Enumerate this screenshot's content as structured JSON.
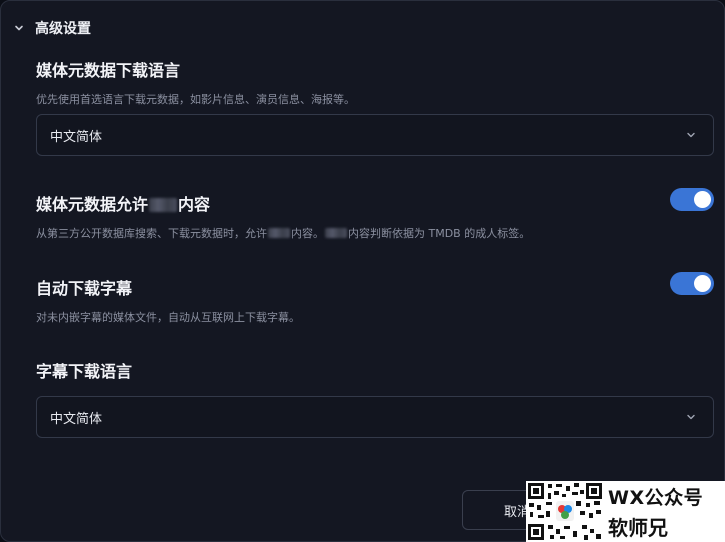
{
  "section": {
    "title": "高级设置",
    "expanded": true
  },
  "metadata_language": {
    "label": "媒体元数据下载语言",
    "description": "优先使用首选语言下载元数据，如影片信息、演员信息、海报等。",
    "selected": "中文简体"
  },
  "adult_content": {
    "label_prefix": "媒体元数据允许",
    "label_suffix": "内容",
    "desc_part1": "从第三方公开数据库搜索、下载元数据时，允许",
    "desc_part2": "内容。",
    "desc_part3": "内容判断依据为 TMDB 的成人标签。",
    "enabled": true
  },
  "auto_subtitles": {
    "label": "自动下载字幕",
    "description": "对未内嵌字幕的媒体文件，自动从互联网上下载字幕。",
    "enabled": true
  },
  "subtitle_language": {
    "label": "字幕下载语言",
    "selected": "中文简体"
  },
  "footer": {
    "cancel_label": "取消"
  },
  "watermark": {
    "line1": "WX公众号",
    "line2": "软师兄"
  },
  "colors": {
    "accent": "#3a75d6",
    "panel": "#141722",
    "border": "#333949"
  }
}
